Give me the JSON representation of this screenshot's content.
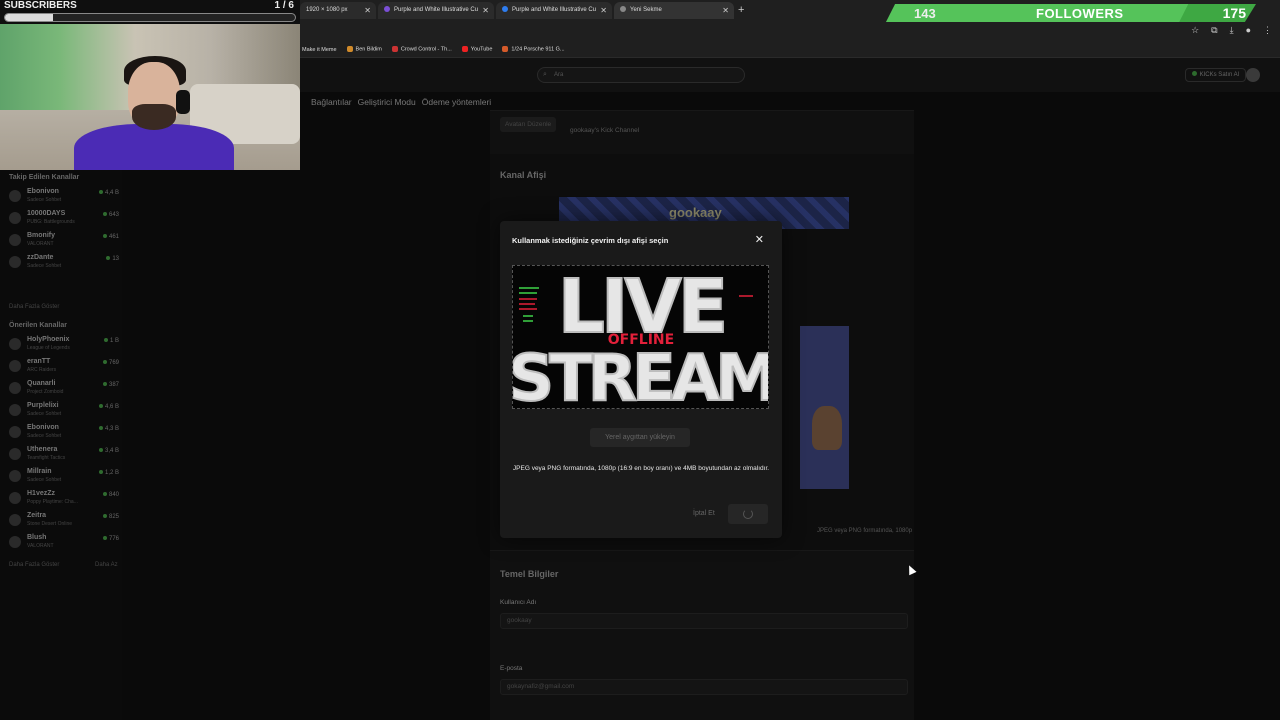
{
  "browser": {
    "tabs": [
      {
        "label": "1920 × 1080 px",
        "color": "#555"
      },
      {
        "label": "Purple and White Illustrative Cu",
        "color": "#7b4fd6"
      },
      {
        "label": "Purple and White Illustrative Cu",
        "color": "#2e7df0"
      },
      {
        "label": "Yeni Sekme",
        "color": "#888"
      }
    ],
    "new_tab_icon": "plus-icon",
    "bookmarks": [
      {
        "label": "Make it Meme",
        "color": "#555"
      },
      {
        "label": "Ben Bildim",
        "color": "#d08a2a"
      },
      {
        "label": "Crowd Control - Th...",
        "color": "#c33"
      },
      {
        "label": "YouTube",
        "color": "#e22"
      },
      {
        "label": "1/24 Porsche 911 G...",
        "color": "#d45a2a"
      }
    ]
  },
  "site": {
    "search_placeholder": "Ara",
    "kicks_label": "KICKs Satın Al",
    "settings_tabs": [
      "Bağlantılar",
      "Geliştirici Modu",
      "Ödeme yöntemleri"
    ]
  },
  "background": {
    "avatar_edit": "Avatarı Düzenle",
    "channel_text": "gookaay's Kick Channel",
    "banner_title": "Kanal Afişi",
    "banner_logo": "gookaay",
    "offline_hint": "JPEG veya PNG formatında, 1080p",
    "basic_info": "Temel Bilgiler",
    "username_label": "Kullanıcı Adı",
    "username_value": "gookaay",
    "email_label": "E-posta",
    "email_value": "gokaynafiz@gmail.com"
  },
  "sidebar": {
    "followed_title": "Takip Edilen Kanallar",
    "followed": [
      {
        "name": "Ebonivon",
        "category": "Sadece Sohbet",
        "viewers": "4,4 B"
      },
      {
        "name": "10000DAYS",
        "category": "PUBG: Battlegrounds",
        "viewers": "643"
      },
      {
        "name": "Bmonify",
        "category": "VALORANT",
        "viewers": "461"
      },
      {
        "name": "zzDante",
        "category": "Sadece Sohbet",
        "viewers": "13"
      }
    ],
    "followed_more": "Daha Fazla Göster",
    "recommended_title": "Önerilen Kanallar",
    "recommended": [
      {
        "name": "HolyPhoenix",
        "category": "League of Legends",
        "viewers": "1 B"
      },
      {
        "name": "eranTT",
        "category": "ARC Raiders",
        "viewers": "769"
      },
      {
        "name": "Quanarli",
        "category": "Project Zomboid",
        "viewers": "387"
      },
      {
        "name": "Purplelixi",
        "category": "Sadece Sohbet",
        "viewers": "4,6 B"
      },
      {
        "name": "Ebonivon",
        "category": "Sadece Sohbet",
        "viewers": "4,3 B"
      },
      {
        "name": "Uthenera",
        "category": "Teamfight Tactics",
        "viewers": "3,4 B"
      },
      {
        "name": "Millrain",
        "category": "Sadece Sohbet",
        "viewers": "1,2 B"
      },
      {
        "name": "H1vezZz",
        "category": "Poppy Playtime: Cha...",
        "viewers": "840"
      },
      {
        "name": "Zeitra",
        "category": "Stone Desert Online",
        "viewers": "825"
      },
      {
        "name": "Blush",
        "category": "VALORANT",
        "viewers": "776"
      }
    ],
    "recommended_more": "Daha Fazla Göster",
    "recommended_less": "Daha Az"
  },
  "overlay": {
    "subscribers_label": "SUBSCRIBERS",
    "subscribers_count": "1 / 6",
    "subscribers_progress": 0.1667,
    "followers_current": "143",
    "followers_label": "FOLLOWERS",
    "followers_goal": "175",
    "followers_progress": 0.817
  },
  "modal": {
    "title": "Kullanmak istediğiniz çevrim dışı afişi seçin",
    "close_icon": "close-icon",
    "preview_big_top": "LIVE",
    "preview_big_bottom": "STREAM",
    "preview_offline": "OFFLINE",
    "upload_label": "Yerel aygıttan yükleyin",
    "info": "JPEG veya PNG formatında, 1080p (16:9 en boy oranı) ve 4MB boyutundan az olmalıdır.",
    "cancel_label": "İptal Et",
    "save_icon": "loading-spinner-icon"
  }
}
